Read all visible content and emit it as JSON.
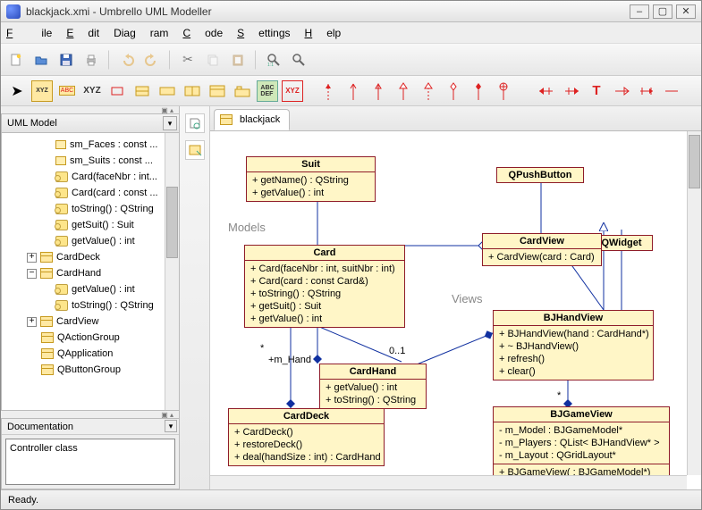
{
  "window": {
    "title": "blackjack.xmi - Umbrello UML Modeller"
  },
  "menu": {
    "file": "File",
    "edit": "Edit",
    "diagram": "Diagram",
    "code": "Code",
    "settings": "Settings",
    "help": "Help"
  },
  "treepanel": {
    "header": "UML Model"
  },
  "tree": {
    "r0": "sm_Faces : const ...",
    "r1": "sm_Suits : const ...",
    "r2": "Card(faceNbr : int...",
    "r3": "Card(card : const ...",
    "r4": "toString() : QString",
    "r5": "getSuit() : Suit",
    "r6": "getValue() : int",
    "r7": "CardDeck",
    "r8": "CardHand",
    "r9": "getValue() : int",
    "r10": "toString() : QString",
    "r11": "CardView",
    "r12": "QActionGroup",
    "r13": "QApplication",
    "r14": "QButtonGroup"
  },
  "docpanel": {
    "header": "Documentation",
    "content": "Controller class"
  },
  "tab": {
    "name": "blackjack"
  },
  "sectionlabels": {
    "models": "Models",
    "views": "Views"
  },
  "uml": {
    "suit": {
      "name": "Suit",
      "m0": "+ getName() : QString",
      "m1": "+ getValue() : int"
    },
    "qpushbutton": {
      "name": "QPushButton"
    },
    "qwidget": {
      "name": "QWidget"
    },
    "card": {
      "name": "Card",
      "m0": "+ Card(faceNbr : int, suitNbr : int)",
      "m1": "+ Card(card : const Card&)",
      "m2": "+ toString() : QString",
      "m3": "+ getSuit() : Suit",
      "m4": "+ getValue() : int"
    },
    "cardview": {
      "name": "CardView",
      "m0": "+ CardView(card : Card)"
    },
    "cardhand": {
      "name": "CardHand",
      "m0": "+ getValue() : int",
      "m1": "+ toString() : QString"
    },
    "carddeck": {
      "name": "CardDeck",
      "m0": "+ CardDeck()",
      "m1": "+ restoreDeck()",
      "m2": "+ deal(handSize : int) : CardHand"
    },
    "bjhandview": {
      "name": "BJHandView",
      "m0": "+ BJHandView(hand : CardHand*)",
      "m1": "+ ~ BJHandView()",
      "m2": "+ refresh()",
      "m3": "+ clear()"
    },
    "bjgameview": {
      "name": "BJGameView",
      "a0": "- m_Model : BJGameModel*",
      "a1": "- m_Players : QList< BJHandView* >",
      "a2": "- m_Layout : QGridLayout*",
      "m0": "+ BJGameView( : BJGameModel*)"
    }
  },
  "assoc": {
    "mhand": "+m_Hand",
    "star1": "*",
    "zeroone": "0..1",
    "star2": "*"
  },
  "status": {
    "text": "Ready."
  }
}
